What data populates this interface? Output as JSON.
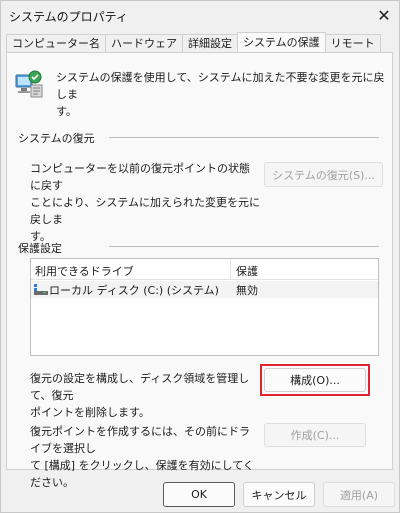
{
  "window": {
    "title": "システムのプロパティ"
  },
  "tabs": [
    {
      "label": "コンピューター名"
    },
    {
      "label": "ハードウェア"
    },
    {
      "label": "詳細設定"
    },
    {
      "label": "システムの保護"
    },
    {
      "label": "リモート"
    }
  ],
  "intro": {
    "line1": "システムの保護を使用して、システムに加えた不要な変更を元に戻しま",
    "line2": "す。"
  },
  "restore": {
    "title": "システムの復元",
    "desc_line1": "コンピューターを以前の復元ポイントの状態に戻す",
    "desc_line2": "ことにより、システムに加えられた変更を元に戻しま",
    "desc_line3": "す。",
    "button": "システムの復元(S)..."
  },
  "protection": {
    "title": "保護設定",
    "columns": [
      "利用できるドライブ",
      "保護"
    ],
    "rows": [
      {
        "drive": "ローカル ディスク (C:) (システム)",
        "status": "無効"
      }
    ],
    "configure_desc_line1": "復元の設定を構成し、ディスク領域を管理して、復元",
    "configure_desc_line2": "ポイントを削除します。",
    "configure_button": "構成(O)...",
    "create_desc_line1": "復元ポイントを作成するには、その前にドライブを選択し",
    "create_desc_line2": "て [構成] をクリックし、保護を有効にしてください。",
    "create_button": "作成(C)..."
  },
  "footer": {
    "ok": "OK",
    "cancel": "キャンセル",
    "apply": "適用(A)"
  },
  "colors": {
    "highlight": "#e0232e",
    "background": "#f0f0f0"
  }
}
